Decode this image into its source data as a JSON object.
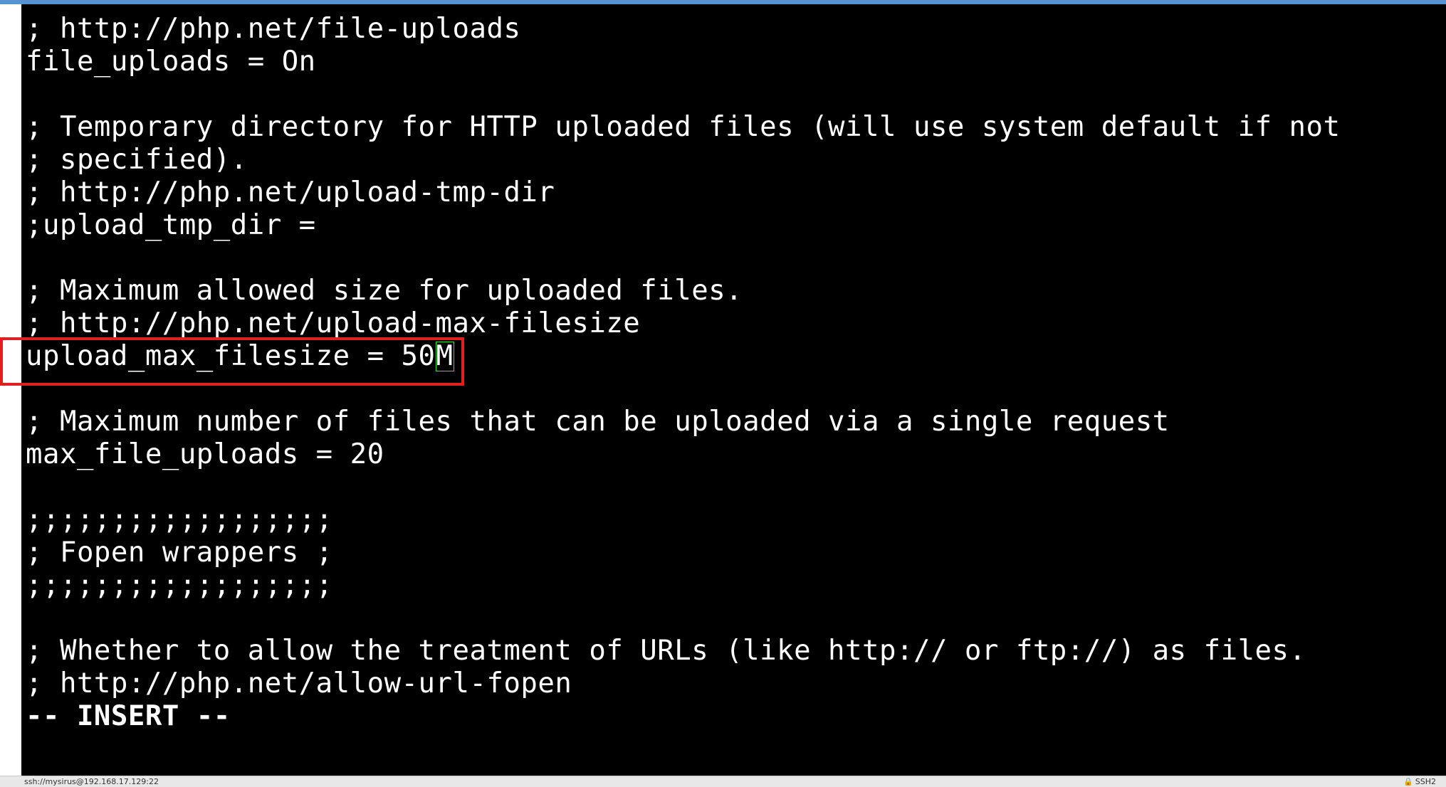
{
  "terminal": {
    "lines": [
      "; http://php.net/file-uploads",
      "file_uploads = On",
      "",
      "; Temporary directory for HTTP uploaded files (will use system default if not",
      "; specified).",
      "; http://php.net/upload-tmp-dir",
      ";upload_tmp_dir =",
      "",
      "; Maximum allowed size for uploaded files.",
      "; http://php.net/upload-max-filesize",
      "",
      "",
      "; Maximum number of files that can be uploaded via a single request",
      "max_file_uploads = 20",
      "",
      ";;;;;;;;;;;;;;;;;;",
      "; Fopen wrappers ;",
      ";;;;;;;;;;;;;;;;;;",
      "",
      "; Whether to allow the treatment of URLs (like http:// or ftp://) as files.",
      "; http://php.net/allow-url-fopen"
    ],
    "edited_line_prefix": "upload_max_filesize = 50",
    "cursor_char": "M",
    "mode_line": "-- INSERT --"
  },
  "statusbar": {
    "connection": "ssh://mysirus@192.168.17.129:22",
    "protocol": "SSH2"
  },
  "colors": {
    "terminal_bg": "#000000",
    "terminal_fg": "#ffffff",
    "highlight": "#e02020",
    "cursor": "#3adf3a"
  }
}
